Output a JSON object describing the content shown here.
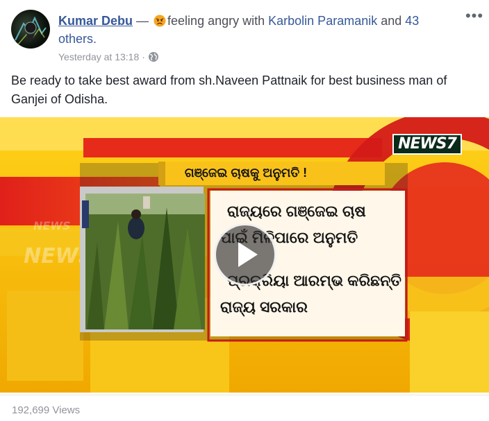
{
  "post": {
    "author": "Kumar Debu",
    "separator": " — ",
    "feeling": "feeling angry with",
    "tagged_person": "Karbolin Paramanik",
    "and_text": " and ",
    "others": "43 others.",
    "timestamp": "Yesterday at 13:18",
    "meta_dot": "·",
    "more_label": "•••",
    "text": "Be ready to take best award from sh.Naveen Pattnaik for best business man of Ganjei of Odisha."
  },
  "video": {
    "headline": "ଗଞ୍ଜେଇ ଚାଷକୁ ଅନୁମତି !",
    "bullet_1": "ରାଜ୍ୟରେ ଗଞ୍ଜେଇ ଚାଷ",
    "bullet_1b": "ପାଇଁ ମିଳିପାରେ ଅନୁମତି",
    "bullet_2": "ପ୍ରକ୍ରିୟା ଆରମ୍ଭ କରିଛନ୍ତି",
    "bullet_2b": "ରାଜ୍ୟ ସରକାର",
    "logo": "NEWS7",
    "watermark": "NEWS7"
  },
  "footer": {
    "views": "192,699 Views"
  },
  "colors": {
    "link": "#365899",
    "meta": "#90949c",
    "video_yellow": "#f3b400",
    "video_red": "#e0201b"
  },
  "icons": [
    "avatar-photo",
    "angry-emoji-icon",
    "globe-icon",
    "more-options-icon",
    "play-icon"
  ]
}
